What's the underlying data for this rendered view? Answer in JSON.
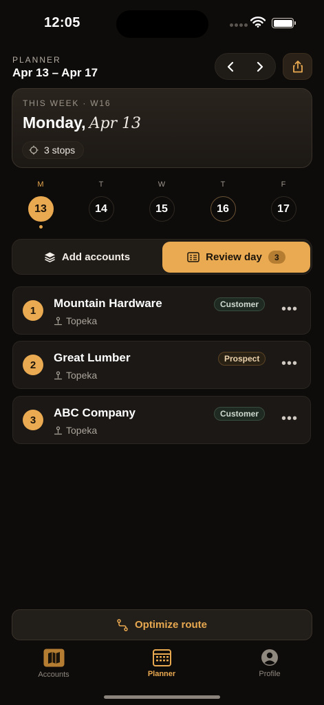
{
  "status_bar": {
    "time": "12:05"
  },
  "header": {
    "kicker": "PLANNER",
    "date_range": "Apr 13 – Apr 17"
  },
  "week_card": {
    "kicker": "THIS WEEK · W16",
    "day_name": "Monday,",
    "day_date": "Apr 13",
    "stops": "3 stops"
  },
  "days": [
    {
      "letter": "M",
      "num": "13",
      "state": "selected"
    },
    {
      "letter": "T",
      "num": "14",
      "state": "normal"
    },
    {
      "letter": "W",
      "num": "15",
      "state": "normal"
    },
    {
      "letter": "T",
      "num": "16",
      "state": "today"
    },
    {
      "letter": "F",
      "num": "17",
      "state": "normal"
    }
  ],
  "segment": {
    "add_label": "Add accounts",
    "review_label": "Review day",
    "review_count": "3"
  },
  "accounts": [
    {
      "index": "1",
      "name": "Mountain Hardware",
      "location": "Topeka",
      "badge": "Customer",
      "badge_type": "customer"
    },
    {
      "index": "2",
      "name": "Great Lumber",
      "location": "Topeka",
      "badge": "Prospect",
      "badge_type": "prospect"
    },
    {
      "index": "3",
      "name": "ABC Company",
      "location": "Topeka",
      "badge": "Customer",
      "badge_type": "customer"
    }
  ],
  "optimize_label": "Optimize route",
  "tabs": [
    {
      "label": "Accounts",
      "icon": "map-icon",
      "active": false
    },
    {
      "label": "Planner",
      "icon": "calendar-icon",
      "active": true
    },
    {
      "label": "Profile",
      "icon": "person-icon",
      "active": false
    }
  ],
  "colors": {
    "accent": "#EAAA52",
    "background": "#0E0C0A",
    "card": "#1B1815",
    "customer_badge": "#1F2A22",
    "prospect_badge": "#2A2115"
  }
}
